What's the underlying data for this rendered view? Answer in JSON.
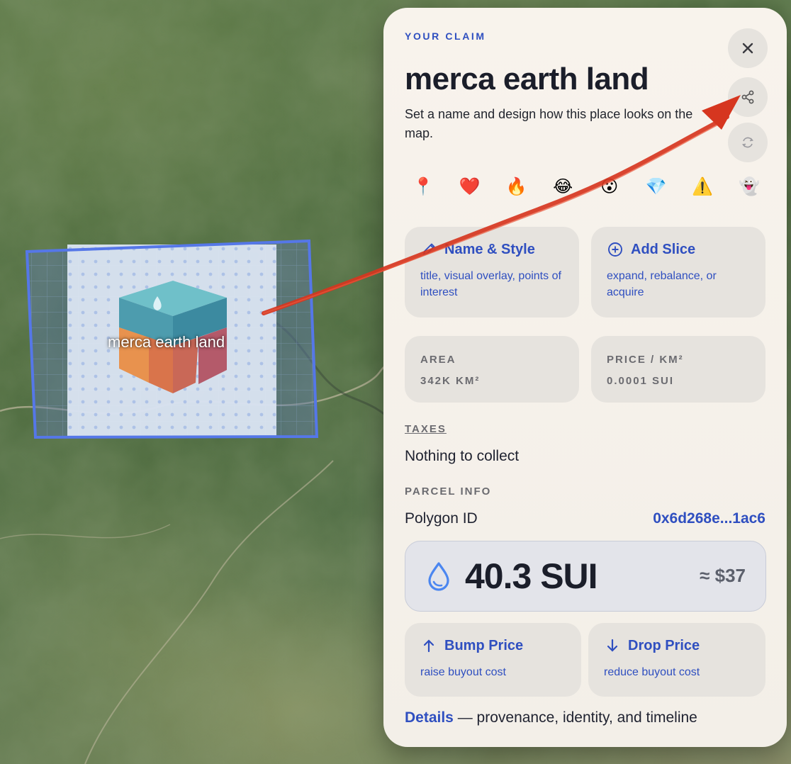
{
  "map": {
    "claim_label": "merca earth land"
  },
  "panel": {
    "eyebrow": "YOUR CLAIM",
    "title": "merca earth land",
    "subtitle": "Set a name and design how this place looks on the map.",
    "buttons": {
      "close_icon": "close-icon",
      "share_icon": "share-icon",
      "refresh_icon": "refresh-icon"
    },
    "emojis": [
      "📍",
      "❤️",
      "🔥",
      "😂",
      "😮",
      "💎",
      "⚠️",
      "👻"
    ],
    "name_style": {
      "title": "Name & Style",
      "sub": "title, visual overlay, points of interest"
    },
    "add_slice": {
      "title": "Add Slice",
      "sub": "expand, rebalance, or acquire"
    },
    "area": {
      "label": "AREA",
      "value": "342K KM²"
    },
    "price_per_km": {
      "label": "PRICE / KM²",
      "value": "0.0001 SUI"
    },
    "taxes": {
      "label": "TAXES",
      "value": "Nothing to collect"
    },
    "parcel": {
      "label": "PARCEL INFO",
      "polygon_label": "Polygon ID",
      "polygon_id": "0x6d268e...1ac6"
    },
    "price": {
      "amount": "40.3 SUI",
      "usd": "≈ $37"
    },
    "bump": {
      "title": "Bump Price",
      "sub": "raise buyout cost"
    },
    "drop": {
      "title": "Drop Price",
      "sub": "reduce buyout cost"
    },
    "details": {
      "link": "Details",
      "rest": " — provenance, identity, and timeline"
    }
  },
  "colors": {
    "accent": "#2f4fc0",
    "claim_outline": "#5577e8",
    "annotation_arrow": "#d6361f"
  }
}
